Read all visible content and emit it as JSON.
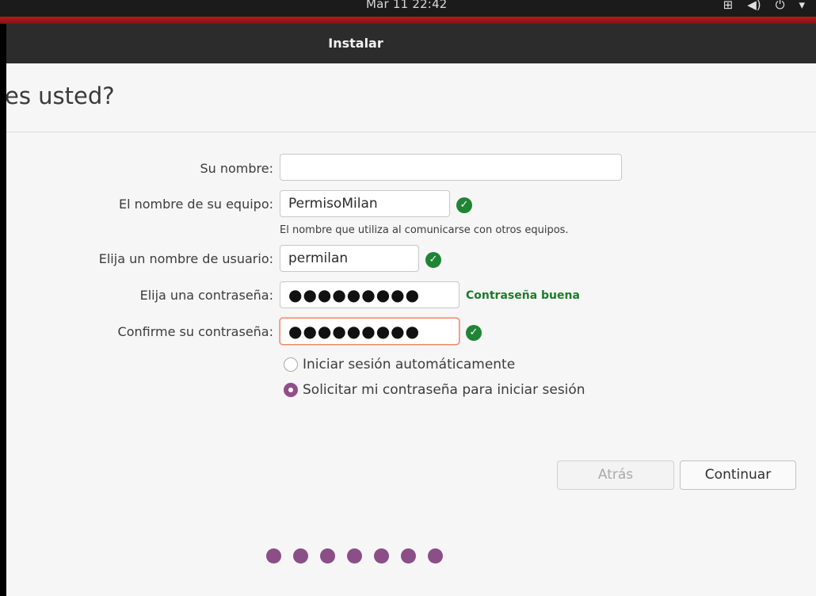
{
  "system_bar": {
    "clock": "Mar 11  22:42",
    "icons": [
      "network-icon",
      "volume-icon",
      "power-icon",
      "menu-arrow-icon"
    ]
  },
  "window": {
    "title": "Instalar",
    "heading": "es usted?"
  },
  "form": {
    "name_label": "Su nombre:",
    "name_value": "",
    "computer_label": "El nombre de su equipo:",
    "computer_value": "PermisoMilan",
    "computer_hint": "El nombre que utiliza al comunicarse con otros equipos.",
    "username_label": "Elija un nombre de usuario:",
    "username_value": "permilan",
    "password_label": "Elija una contraseña:",
    "password_value": "●●●●●●●●●",
    "password_strength": "Contraseña buena",
    "confirm_label": "Confirme su contraseña:",
    "confirm_value": "●●●●●●●●●",
    "auto_login_label": "Iniciar sesión automáticamente",
    "require_password_label": "Solicitar mi contraseña para iniciar sesión",
    "selected_login_option": "require_password"
  },
  "buttons": {
    "back": "Atrás",
    "continue": "Continuar"
  },
  "colors": {
    "accent": "#924d8b",
    "check": "#1f8534",
    "headerbar": "#2c2c2c",
    "topline": "#b31a1a"
  }
}
